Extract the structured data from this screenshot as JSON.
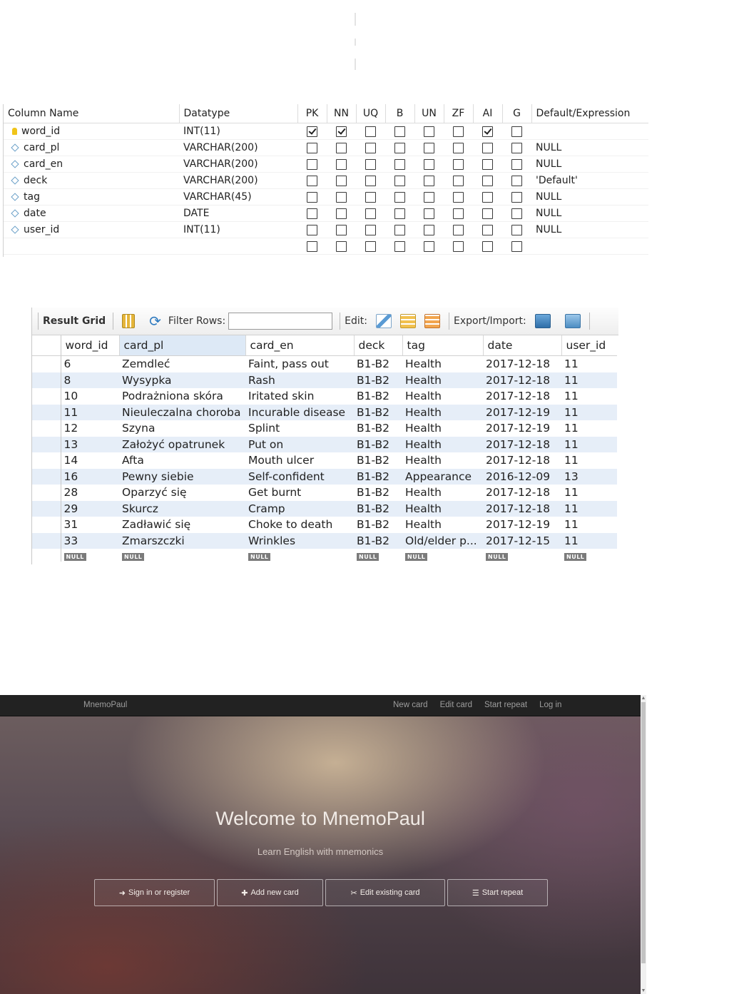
{
  "schema": {
    "headers": [
      "Column Name",
      "Datatype",
      "PK",
      "NN",
      "UQ",
      "B",
      "UN",
      "ZF",
      "AI",
      "G",
      "Default/Expression"
    ],
    "rows": [
      {
        "name": "word_id",
        "icon": "key-icon",
        "type": "INT(11)",
        "flags": [
          true,
          true,
          false,
          false,
          false,
          false,
          true,
          false
        ],
        "default": ""
      },
      {
        "name": "card_pl",
        "icon": "column-icon",
        "type": "VARCHAR(200)",
        "flags": [
          false,
          false,
          false,
          false,
          false,
          false,
          false,
          false
        ],
        "default": "NULL"
      },
      {
        "name": "card_en",
        "icon": "column-icon",
        "type": "VARCHAR(200)",
        "flags": [
          false,
          false,
          false,
          false,
          false,
          false,
          false,
          false
        ],
        "default": "NULL"
      },
      {
        "name": "deck",
        "icon": "column-icon",
        "type": "VARCHAR(200)",
        "flags": [
          false,
          false,
          false,
          false,
          false,
          false,
          false,
          false
        ],
        "default": "'Default'"
      },
      {
        "name": "tag",
        "icon": "column-icon",
        "type": "VARCHAR(45)",
        "flags": [
          false,
          false,
          false,
          false,
          false,
          false,
          false,
          false
        ],
        "default": "NULL"
      },
      {
        "name": "date",
        "icon": "column-icon",
        "type": "DATE",
        "flags": [
          false,
          false,
          false,
          false,
          false,
          false,
          false,
          false
        ],
        "default": "NULL"
      },
      {
        "name": "user_id",
        "icon": "column-icon",
        "type": "INT(11)",
        "flags": [
          false,
          false,
          false,
          false,
          false,
          false,
          false,
          false
        ],
        "default": "NULL"
      }
    ]
  },
  "result_grid": {
    "toolbar": {
      "title": "Result Grid",
      "filter_label": "Filter Rows:",
      "filter_value": "",
      "edit_label": "Edit:",
      "export_label": "Export/Import:"
    },
    "columns": [
      "word_id",
      "card_pl",
      "card_en",
      "deck",
      "tag",
      "date",
      "user_id"
    ],
    "rows": [
      [
        "6",
        "Zemdleć",
        "Faint, pass out",
        "B1-B2",
        "Health",
        "2017-12-18",
        "11"
      ],
      [
        "8",
        "Wysypka",
        "Rash",
        "B1-B2",
        "Health",
        "2017-12-18",
        "11"
      ],
      [
        "10",
        "Podrażniona skóra",
        "Iritated skin",
        "B1-B2",
        "Health",
        "2017-12-18",
        "11"
      ],
      [
        "11",
        "Nieuleczalna choroba",
        "Incurable disease",
        "B1-B2",
        "Health",
        "2017-12-19",
        "11"
      ],
      [
        "12",
        "Szyna",
        "Splint",
        "B1-B2",
        "Health",
        "2017-12-19",
        "11"
      ],
      [
        "13",
        "Założyć opatrunek",
        "Put on",
        "B1-B2",
        "Health",
        "2017-12-18",
        "11"
      ],
      [
        "14",
        "Afta",
        "Mouth ulcer",
        "B1-B2",
        "Health",
        "2017-12-18",
        "11"
      ],
      [
        "16",
        "Pewny siebie",
        "Self-confident",
        "B1-B2",
        "Appearance",
        "2016-12-09",
        "13"
      ],
      [
        "28",
        "Oparzyć się",
        "Get burnt",
        "B1-B2",
        "Health",
        "2017-12-18",
        "11"
      ],
      [
        "29",
        "Skurcz",
        "Cramp",
        "B1-B2",
        "Health",
        "2017-12-18",
        "11"
      ],
      [
        "31",
        "Zadławić się",
        "Choke to death",
        "B1-B2",
        "Health",
        "2017-12-19",
        "11"
      ],
      [
        "33",
        "Zmarszczki",
        "Wrinkles",
        "B1-B2",
        "Old/elder p...",
        "2017-12-15",
        "11"
      ]
    ],
    "null_label": "NULL"
  },
  "app": {
    "brand": "MnemoPaul",
    "nav": [
      "New card",
      "Edit card",
      "Start repeat",
      "Log in"
    ],
    "title": "Welcome to MnemoPaul",
    "subtitle": "Learn English with mnemonics",
    "buttons": [
      {
        "label": "Sign in or register",
        "icon": "sign-in-icon",
        "glyph": "➜"
      },
      {
        "label": "Add new card",
        "icon": "plus-icon",
        "glyph": "✚"
      },
      {
        "label": "Edit existing card",
        "icon": "scissors-icon",
        "glyph": "✂"
      },
      {
        "label": "Start repeat",
        "icon": "list-icon",
        "glyph": "☰"
      }
    ]
  }
}
